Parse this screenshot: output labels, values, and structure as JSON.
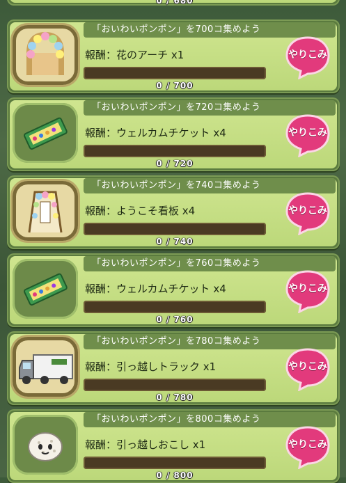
{
  "top_partial": {
    "progress": "0 / 680"
  },
  "missions": [
    {
      "title": "「おいわいポンポン」を700コ集めよう",
      "reward": "報酬：花のアーチ x1",
      "progress": "0 / 700",
      "button": "やりこみ",
      "icon": "flower-arch-icon",
      "framed": true,
      "fraction": 0
    },
    {
      "title": "「おいわいポンポン」を720コ集めよう",
      "reward": "報酬：ウェルカムチケット x4",
      "progress": "0 / 720",
      "button": "やりこみ",
      "icon": "welcome-ticket-icon",
      "framed": false,
      "fraction": 0
    },
    {
      "title": "「おいわいポンポン」を740コ集めよう",
      "reward": "報酬：ようこそ看板 x4",
      "progress": "0 / 740",
      "button": "やりこみ",
      "icon": "welcome-sign-icon",
      "framed": true,
      "fraction": 0
    },
    {
      "title": "「おいわいポンポン」を760コ集めよう",
      "reward": "報酬：ウェルカムチケット x4",
      "progress": "0 / 760",
      "button": "やりこみ",
      "icon": "welcome-ticket-icon",
      "framed": false,
      "fraction": 0
    },
    {
      "title": "「おいわいポンポン」を780コ集めよう",
      "reward": "報酬：引っ越しトラック x1",
      "progress": "0 / 780",
      "button": "やりこみ",
      "icon": "moving-truck-icon",
      "framed": true,
      "fraction": 0
    },
    {
      "title": "「おいわいポンポン」を800コ集めよう",
      "reward": "報酬：引っ越しおこし x1",
      "progress": "0 / 800",
      "button": "やりこみ",
      "icon": "okoshi-snack-icon",
      "framed": false,
      "fraction": 0
    }
  ]
}
